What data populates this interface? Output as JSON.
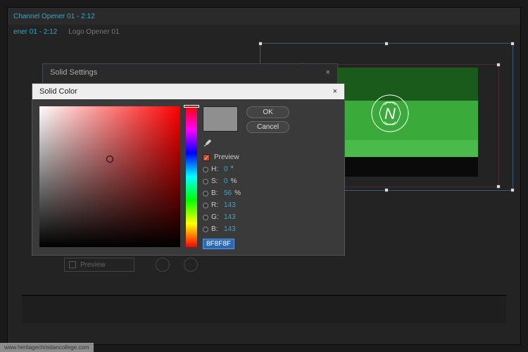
{
  "toolbar": {
    "item1": "Channel Opener 01 - 2:12",
    "item2_dim": "",
    "item3_dim": ""
  },
  "tabs": {
    "tab1": "ener 01 - 2:12",
    "tab2": "Logo Opener 01"
  },
  "solid_settings": {
    "title": "Solid Settings",
    "close": "×"
  },
  "color_dialog": {
    "title": "Solid Color",
    "close": "×",
    "ok": "OK",
    "cancel": "Cancel",
    "preview_label": "Preview",
    "fields": {
      "h": {
        "label": "H:",
        "value": "0",
        "unit": "°"
      },
      "s": {
        "label": "S:",
        "value": "0",
        "unit": "%"
      },
      "b1": {
        "label": "B:",
        "value": "56",
        "unit": "%"
      },
      "r": {
        "label": "R:",
        "value": "143",
        "unit": ""
      },
      "g": {
        "label": "G:",
        "value": "143",
        "unit": ""
      },
      "b2": {
        "label": "B:",
        "value": "143",
        "unit": ""
      }
    },
    "hex": "8F8F8F",
    "swatch_color": "#8f8f8f"
  },
  "extra": {
    "label": "Preview"
  },
  "footer": "www.heritagechristiancollege.com"
}
